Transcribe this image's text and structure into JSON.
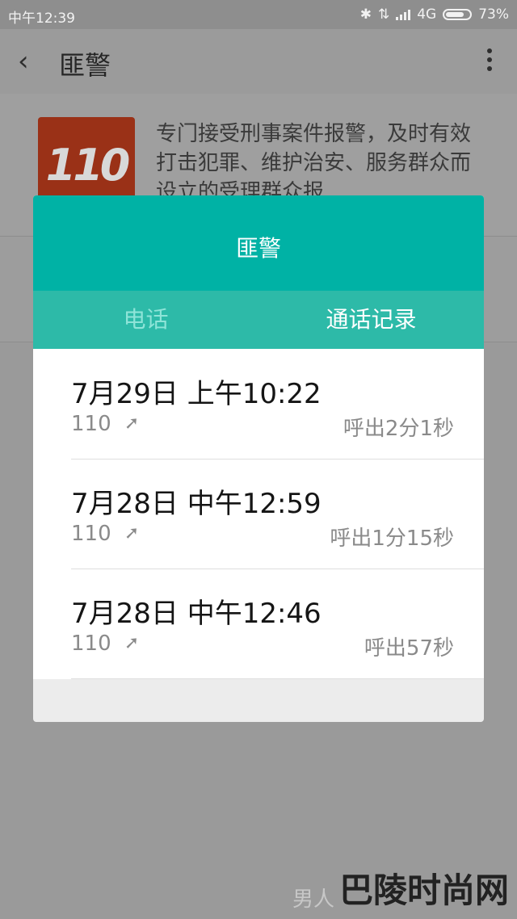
{
  "status_bar": {
    "time": "中午12:39",
    "network": "4G",
    "battery": "73%"
  },
  "app_bar": {
    "title": "匪警",
    "back_icon": "back-chevron-icon",
    "menu_icon": "more-vertical-icon"
  },
  "contact": {
    "logo_text": "110",
    "description": "专门接受刑事案件报警，及时有效打击犯罪、维护治安、服务群众而设立的受理群众报",
    "colors": {
      "logo_bg": "#9a3117"
    }
  },
  "dialog": {
    "title": "匪警",
    "tabs": [
      {
        "label": "电话",
        "active": false
      },
      {
        "label": "通话记录",
        "active": true
      }
    ],
    "calls": [
      {
        "time": "7月29日 上午10:22",
        "number": "110",
        "duration": "呼出2分1秒",
        "direction_icon": "outgoing-arrow-icon"
      },
      {
        "time": "7月28日 中午12:59",
        "number": "110",
        "duration": "呼出1分15秒",
        "direction_icon": "outgoing-arrow-icon"
      },
      {
        "time": "7月28日 中午12:46",
        "number": "110",
        "duration": "呼出57秒",
        "direction_icon": "outgoing-arrow-icon"
      }
    ],
    "colors": {
      "header": "#00b2a5",
      "tabs": "#2dbaa8"
    }
  },
  "watermark": {
    "faint": "男人",
    "main": "巴陵时尚网"
  }
}
